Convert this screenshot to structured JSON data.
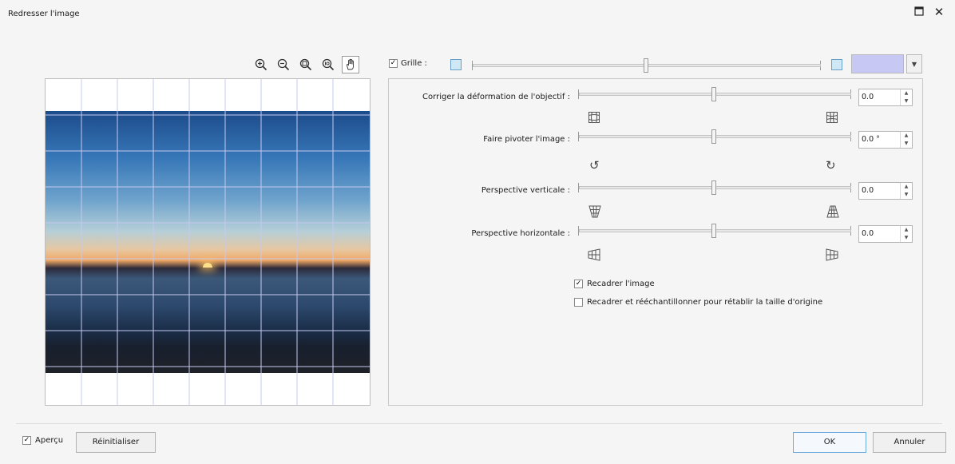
{
  "window": {
    "title": "Redresser l'image",
    "maximize_icon": "maximize-icon",
    "close_icon": "close-icon"
  },
  "zoom_tools": [
    "zoom-in-icon",
    "zoom-out-icon",
    "zoom-fit-icon",
    "zoom-100-icon",
    "hand-pan-icon"
  ],
  "grid": {
    "label": "Grille :",
    "checked": true,
    "color": "#c7c9f4",
    "slider_value": 0.5
  },
  "controls": [
    {
      "label": "Corriger la déformation de l'objectif :",
      "value": "0.0",
      "left_icon": "barrel-distortion-icon",
      "right_icon": "pincushion-distortion-icon",
      "slider_value": 0.5
    },
    {
      "label": "Faire pivoter l'image :",
      "value": "0.0 °",
      "left_icon": "rotate-left-icon",
      "right_icon": "rotate-right-icon",
      "slider_value": 0.5
    },
    {
      "label": "Perspective verticale :",
      "value": "0.0",
      "left_icon": "perspective-vertical-left-icon",
      "right_icon": "perspective-vertical-right-icon",
      "slider_value": 0.5
    },
    {
      "label": "Perspective horizontale :",
      "value": "0.0",
      "left_icon": "perspective-horizontal-left-icon",
      "right_icon": "perspective-horizontal-right-icon",
      "slider_value": 0.5
    }
  ],
  "options": {
    "crop": {
      "label": "Recadrer l'image",
      "checked": true
    },
    "crop_resample": {
      "label": "Recadrer et rééchantillonner pour rétablir la taille d'origine",
      "checked": false
    }
  },
  "footer": {
    "preview_label": "Aperçu",
    "preview_checked": true,
    "reset_label": "Réinitialiser",
    "ok_label": "OK",
    "cancel_label": "Annuler"
  }
}
